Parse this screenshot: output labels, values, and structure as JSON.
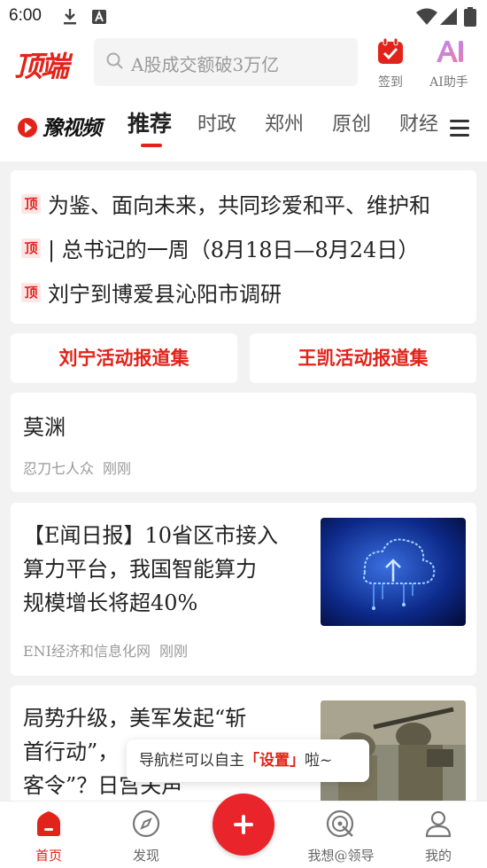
{
  "status_bar": {
    "time": "6:00"
  },
  "header": {
    "logo": "顶端",
    "search_placeholder": "A股成交额破3万亿",
    "checkin_label": "签到",
    "ai_label": "AI助手"
  },
  "tabs": {
    "brand": "豫视频",
    "items": [
      "推荐",
      "时政",
      "郑州",
      "原创",
      "财经"
    ],
    "active": "推荐"
  },
  "headlines": {
    "badge": "顶",
    "items": [
      "为鉴、面向未来，共同珍爱和平、维护和",
      "| 总书记的一周（8月18日—8月24日）",
      "刘宁到博爱县沁阳市调研"
    ]
  },
  "reports": [
    "刘宁活动报道集",
    "王凯活动报道集"
  ],
  "feed": [
    {
      "title": "莫渊",
      "source": "忍刀七人众",
      "time": "刚刚"
    },
    {
      "title_lines": [
        "【E闻日报】10省区市接入",
        "算力平台，我国智能算力",
        "规模增长将超40%"
      ],
      "source": "ENI经济和信息化网",
      "time": "刚刚"
    },
    {
      "title_lines": [
        "局势升级，美军发起“斩",
        "首行动”，",
        "客令”？日宫关声"
      ]
    }
  ],
  "tooltip": {
    "prefix": "导航栏可以自主",
    "highlight": "「设置」",
    "suffix": "啦~"
  },
  "bottom_nav": {
    "items": [
      "首页",
      "发现",
      "我想@领导",
      "我的"
    ],
    "active": "首页"
  },
  "colors": {
    "brand_red": "#e2231a",
    "bg": "#f2f2f2"
  },
  "icons": [
    "download-icon",
    "a-badge-icon",
    "wifi-icon",
    "signal-icon",
    "battery-icon",
    "search-icon",
    "checkin-icon",
    "ai-assistant-icon",
    "menu-icon",
    "home-icon",
    "compass-icon",
    "plus-icon",
    "target-icon",
    "user-icon"
  ]
}
